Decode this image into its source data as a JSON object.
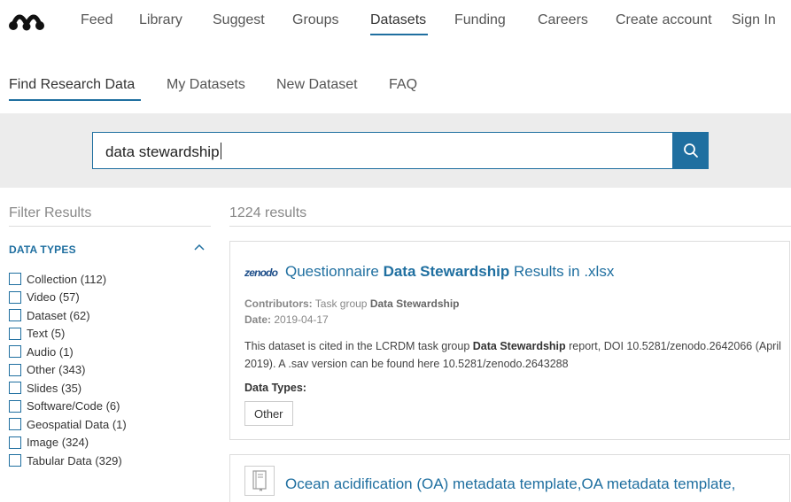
{
  "topnav": {
    "logo": "mendeley-logo-icon",
    "items": [
      "Feed",
      "Library",
      "Suggest",
      "Groups",
      "Datasets",
      "Funding",
      "Careers",
      "Create account",
      "Sign In"
    ],
    "active": "Datasets"
  },
  "subnav": {
    "items": [
      "Find Research Data",
      "My Datasets",
      "New Dataset",
      "FAQ"
    ],
    "active": "Find Research Data"
  },
  "search": {
    "value": "data stewardship",
    "button_icon": "search-icon"
  },
  "filters": {
    "title": "Filter Results",
    "section_title": "DATA TYPES",
    "items": [
      "Collection (112)",
      "Video (57)",
      "Dataset (62)",
      "Text (5)",
      "Audio (1)",
      "Other (343)",
      "Slides (35)",
      "Software/Code (6)",
      "Geospatial Data (1)",
      "Image (324)",
      "Tabular Data (329)"
    ]
  },
  "results": {
    "count": "1224 results",
    "cards": [
      {
        "source_logo": "zenodo",
        "title_pre": "Questionnaire ",
        "title_bold": "Data Stewardship",
        "title_post": " Results in .xlsx",
        "contributors_label": "Contributors:",
        "contributors_pre": " Task group ",
        "contributors_bold": "Data  Stewardship",
        "date_label": "Date:",
        "date": " 2019-04-17",
        "desc_pre": "This dataset is cited in the LCRDM task group ",
        "desc_bold": "Data Stewardship",
        "desc_post": " report, DOI 10.5281/zenodo.2642066 (April 2019). A .sav version can be found here 10.5281/zenodo.2643288",
        "data_types_label": "Data Types:",
        "tag": "Other"
      },
      {
        "icon": "book-icon",
        "title": "Ocean acidification (OA) metadata template,OA metadata template,"
      }
    ]
  },
  "colors": {
    "accent": "#1f6fa0",
    "search_band": "#ececec",
    "border": "#dddddd"
  }
}
